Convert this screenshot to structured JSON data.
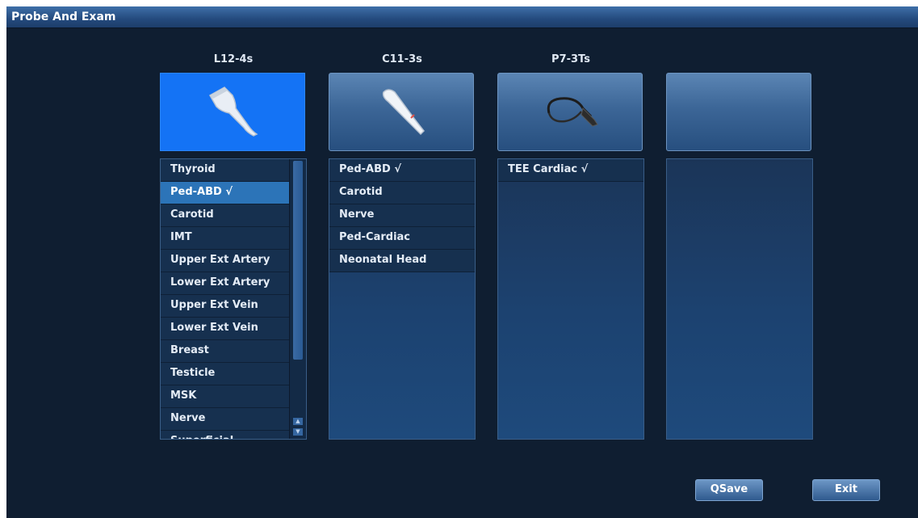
{
  "window": {
    "title": "Probe And Exam"
  },
  "probes": [
    {
      "name": "L12-4s",
      "icon": "linear-probe-icon",
      "selected": true,
      "exams": [
        "Thyroid",
        "Ped-ABD √",
        "Carotid",
        "IMT",
        "Upper Ext Artery",
        "Lower Ext Artery",
        "Upper Ext Vein",
        "Lower Ext Vein",
        "Breast",
        "Testicle",
        "MSK",
        "Nerve",
        "Superficial"
      ],
      "selected_exam": "Ped-ABD √"
    },
    {
      "name": "C11-3s",
      "icon": "convex-probe-icon",
      "selected": false,
      "exams": [
        "Ped-ABD √",
        "Carotid",
        "Nerve",
        "Ped-Cardiac",
        "Neonatal Head"
      ],
      "selected_exam": ""
    },
    {
      "name": "P7-3Ts",
      "icon": "tee-probe-icon",
      "selected": false,
      "exams": [
        "TEE Cardiac √"
      ],
      "selected_exam": ""
    },
    {
      "name": "",
      "icon": "",
      "selected": false,
      "exams": [],
      "selected_exam": ""
    }
  ],
  "buttons": {
    "qsave": "QSave",
    "exit": "Exit"
  },
  "colors": {
    "background": "#0f1e31",
    "titlebar": "#2a5488",
    "selected_tile": "#1473f5",
    "selected_item": "#2c74b8"
  }
}
